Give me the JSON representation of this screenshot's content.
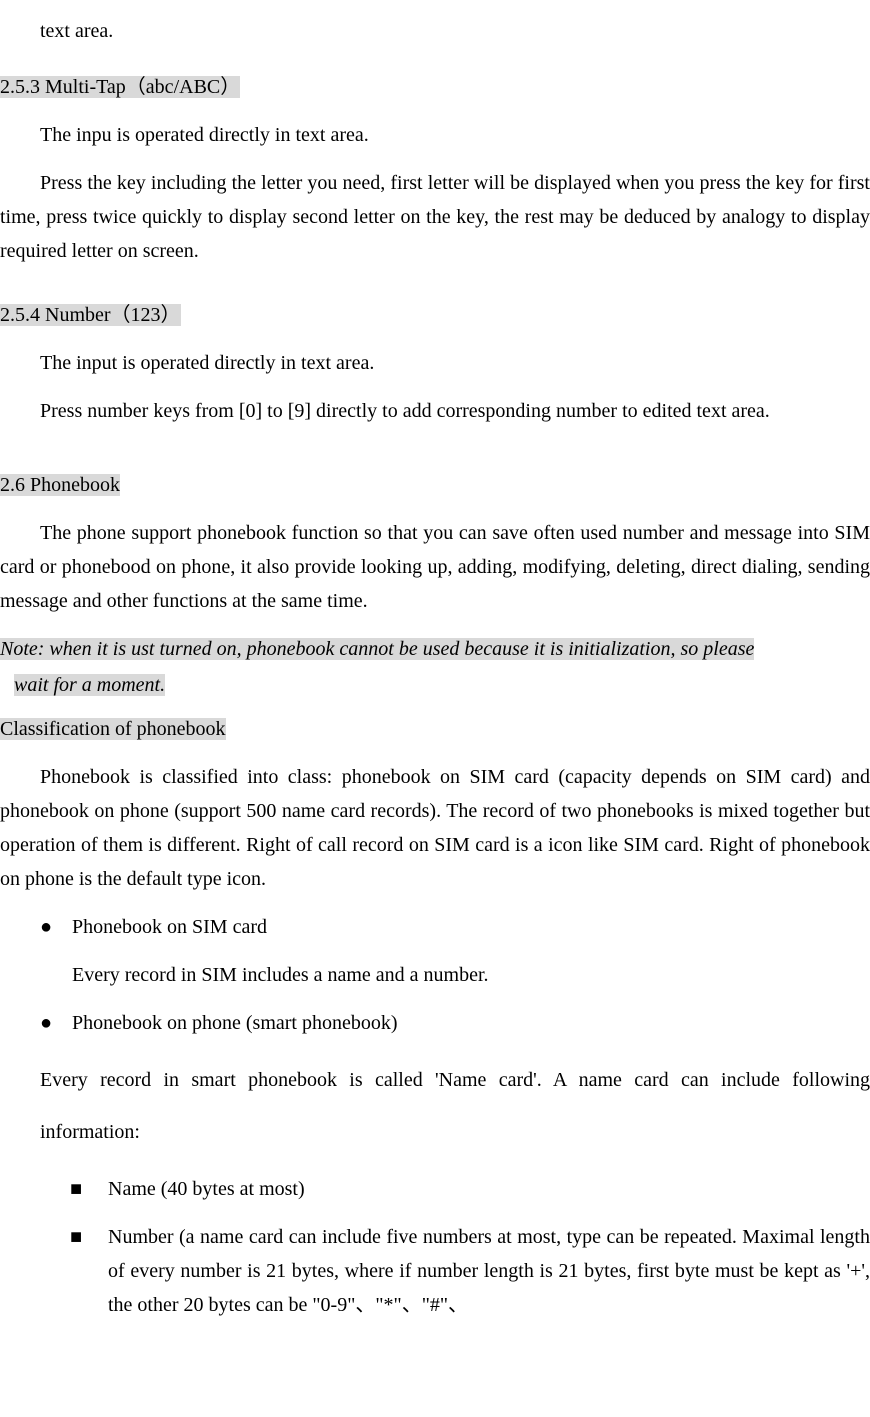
{
  "frag_top": "text area.",
  "h253": "2.5.3 Multi-Tap（abc/ABC）",
  "p253_1": "The inpu is operated directly in text area.",
  "p253_2": "Press the key including the letter you need, first letter will be displayed when you press the key for first time, press twice quickly to display second letter on the key, the rest may be deduced by analogy to display required letter on screen.",
  "h254": "2.5.4 Number（123）",
  "p254_1": "The input is operated directly in text area.",
  "p254_2": "Press number keys from [0] to [9] directly to add corresponding number to edited text area.",
  "h26": "2.6 Phonebook",
  "p26_1": "The phone support phonebook function so that you can save often used number and message into SIM card or phonebood on phone, it also provide looking up, adding, modifying, deleting, direct dialing, sending message and other functions at the same time.",
  "note_l1": "Note: when it is ust turned on, phonebook cannot be used because it is initialization, so please",
  "note_l2": "wait for a moment.",
  "h_class": "Classification of phonebook",
  "p_class_1": "Phonebook is classified into class: phonebook on SIM card (capacity depends on SIM card) and phonebook on phone (support 500 name card records). The record of two phonebooks is mixed together but operation of them is different. Right of call record on SIM card is a icon like SIM card. Right of phonebook on phone is the default type icon.",
  "bullets": {
    "b1": "Phonebook on SIM card",
    "b1_sub": "Every record in SIM includes a name and a number.",
    "b2": "Phonebook on phone (smart phonebook)"
  },
  "p_after_b2_1": "Every record in smart phonebook is called 'Name card'. A name card can include following information:",
  "squares": {
    "s1": "Name (40 bytes at most)",
    "s2": "Number (a name card can include five numbers at most, type can be repeated. Maximal length of every number is 21 bytes, where if number length is 21 bytes, first byte must be kept as '+', the other 20 bytes can be \"0-9\"、\"*\"、\"#\"、"
  }
}
